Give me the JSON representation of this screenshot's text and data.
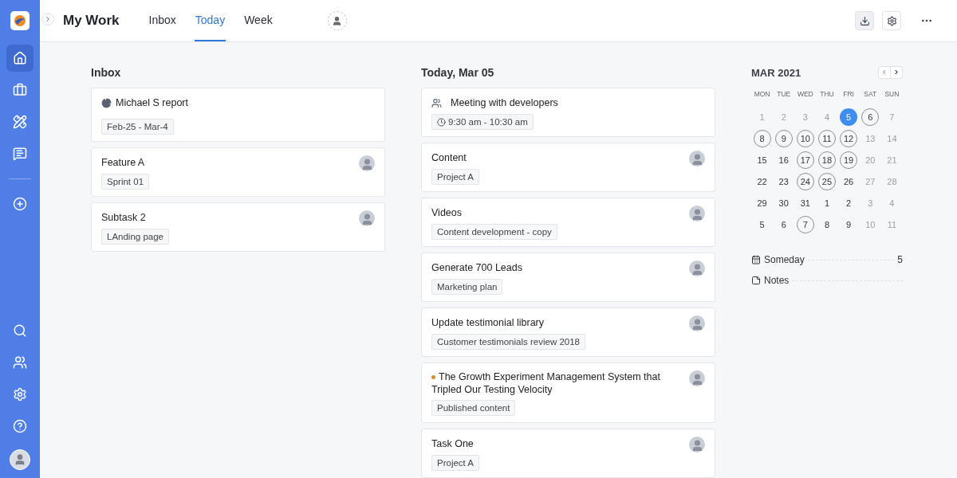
{
  "sidebar": {
    "top": [
      {
        "selected": true
      },
      {
        "selected": false
      },
      {
        "selected": false
      },
      {
        "selected": false
      },
      {
        "selected": false
      }
    ],
    "bottom": [
      {
        "selected": false
      },
      {
        "selected": false
      },
      {
        "selected": false
      },
      {
        "selected": false
      }
    ]
  },
  "header": {
    "title": "My Work",
    "tabs": [
      {
        "label": "Inbox",
        "selected": false
      },
      {
        "label": "Today",
        "selected": true
      },
      {
        "label": "Week",
        "selected": false
      }
    ],
    "actions": [
      {
        "kind": "inbox",
        "selected": true
      },
      {
        "kind": "settings",
        "selected": false
      },
      {
        "kind": "more",
        "selected": false
      }
    ]
  },
  "inbox": {
    "title": "Inbox",
    "cards": [
      {
        "kind": "report",
        "title": "Michael S report",
        "tag": "Feb-25 - Mar-4",
        "avatar": false
      },
      {
        "kind": "task",
        "title": "Feature A",
        "tag": "Sprint 01",
        "avatar": true
      },
      {
        "kind": "task",
        "title": "Subtask 2",
        "tag": "LAnding page",
        "avatar": true
      }
    ]
  },
  "today": {
    "title": "Today, Mar 05",
    "cards": [
      {
        "kind": "meeting",
        "title": "Meeting with developers",
        "tag": "9:30 am - 10:30 am",
        "avatar": false
      },
      {
        "kind": "task",
        "title": "Content",
        "tag": "Project A",
        "avatar": true
      },
      {
        "kind": "task",
        "title": "Videos",
        "tag": "Content development - copy",
        "avatar": true
      },
      {
        "kind": "task",
        "title": "Generate 700 Leads",
        "tag": "Marketing plan",
        "avatar": true
      },
      {
        "kind": "task",
        "title": "Update testimonial library",
        "tag": "Customer testimonials review 2018",
        "avatar": true
      },
      {
        "kind": "task",
        "title": "The Growth Experiment Management System that Tripled Our Testing Velocity",
        "tag": "Published content",
        "avatar": true,
        "color": "#e08a2c"
      },
      {
        "kind": "task",
        "title": "Task One",
        "tag": "Project A",
        "avatar": true
      }
    ]
  },
  "calendar": {
    "title": "MAR 2021",
    "prev": "‹",
    "next": "›",
    "weekdays": [
      "MON",
      "TUE",
      "WED",
      "THU",
      "FRI",
      "SAT",
      "SUN"
    ],
    "weeks": [
      [
        {
          "day": "1",
          "muted": true,
          "ringed": false,
          "selected": false
        },
        {
          "day": "2",
          "muted": true,
          "ringed": false,
          "selected": false
        },
        {
          "day": "3",
          "muted": true,
          "ringed": false,
          "selected": false
        },
        {
          "day": "4",
          "muted": true,
          "ringed": false,
          "selected": false
        },
        {
          "day": "5",
          "muted": false,
          "ringed": false,
          "selected": true
        },
        {
          "day": "6",
          "muted": false,
          "ringed": true,
          "selected": false
        },
        {
          "day": "7",
          "muted": true,
          "ringed": false,
          "selected": false
        }
      ],
      [
        {
          "day": "8",
          "muted": false,
          "ringed": true,
          "selected": false
        },
        {
          "day": "9",
          "muted": false,
          "ringed": true,
          "selected": false
        },
        {
          "day": "10",
          "muted": false,
          "ringed": true,
          "selected": false
        },
        {
          "day": "11",
          "muted": false,
          "ringed": true,
          "selected": false
        },
        {
          "day": "12",
          "muted": false,
          "ringed": true,
          "selected": false
        },
        {
          "day": "13",
          "muted": true,
          "ringed": false,
          "selected": false
        },
        {
          "day": "14",
          "muted": true,
          "ringed": false,
          "selected": false
        }
      ],
      [
        {
          "day": "15",
          "muted": false,
          "ringed": false,
          "selected": false
        },
        {
          "day": "16",
          "muted": false,
          "ringed": false,
          "selected": false
        },
        {
          "day": "17",
          "muted": false,
          "ringed": true,
          "selected": false
        },
        {
          "day": "18",
          "muted": false,
          "ringed": true,
          "selected": false
        },
        {
          "day": "19",
          "muted": false,
          "ringed": true,
          "selected": false
        },
        {
          "day": "20",
          "muted": true,
          "ringed": false,
          "selected": false
        },
        {
          "day": "21",
          "muted": true,
          "ringed": false,
          "selected": false
        }
      ],
      [
        {
          "day": "22",
          "muted": false,
          "ringed": false,
          "selected": false
        },
        {
          "day": "23",
          "muted": false,
          "ringed": false,
          "selected": false
        },
        {
          "day": "24",
          "muted": false,
          "ringed": true,
          "selected": false
        },
        {
          "day": "25",
          "muted": false,
          "ringed": true,
          "selected": false
        },
        {
          "day": "26",
          "muted": false,
          "ringed": false,
          "selected": false
        },
        {
          "day": "27",
          "muted": true,
          "ringed": false,
          "selected": false
        },
        {
          "day": "28",
          "muted": true,
          "ringed": false,
          "selected": false
        }
      ],
      [
        {
          "day": "29",
          "muted": false,
          "ringed": false,
          "selected": false
        },
        {
          "day": "30",
          "muted": false,
          "ringed": false,
          "selected": false
        },
        {
          "day": "31",
          "muted": false,
          "ringed": false,
          "selected": false
        },
        {
          "day": "1",
          "muted": false,
          "ringed": false,
          "selected": false
        },
        {
          "day": "2",
          "muted": false,
          "ringed": false,
          "selected": false
        },
        {
          "day": "3",
          "muted": true,
          "ringed": false,
          "selected": false
        },
        {
          "day": "4",
          "muted": true,
          "ringed": false,
          "selected": false
        }
      ],
      [
        {
          "day": "5",
          "muted": false,
          "ringed": false,
          "selected": false
        },
        {
          "day": "6",
          "muted": false,
          "ringed": false,
          "selected": false
        },
        {
          "day": "7",
          "muted": false,
          "ringed": true,
          "selected": false
        },
        {
          "day": "8",
          "muted": false,
          "ringed": false,
          "selected": false
        },
        {
          "day": "9",
          "muted": false,
          "ringed": false,
          "selected": false
        },
        {
          "day": "10",
          "muted": true,
          "ringed": false,
          "selected": false
        },
        {
          "day": "11",
          "muted": true,
          "ringed": false,
          "selected": false
        }
      ]
    ]
  },
  "lists": [
    {
      "kind": "someday",
      "label": "Someday",
      "count": "5"
    },
    {
      "kind": "notes",
      "label": "Notes"
    }
  ]
}
